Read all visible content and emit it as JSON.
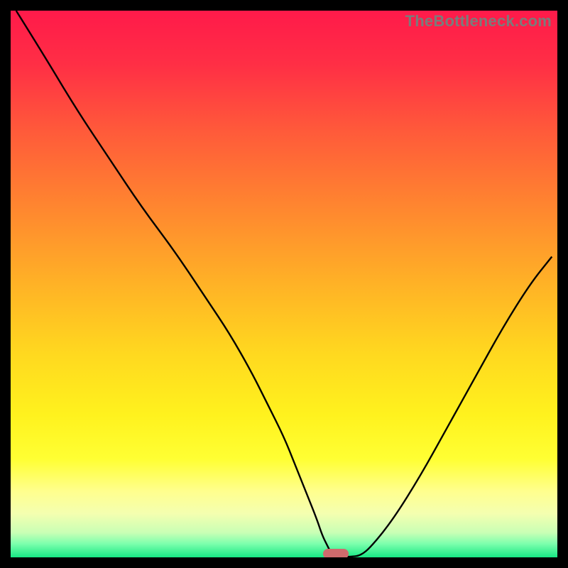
{
  "watermark": "TheBottleneck.com",
  "colors": {
    "frame": "#000000",
    "watermark": "#7b7b7b",
    "curve": "#000000",
    "sweet_spot": "#cf6b6d",
    "gradient_stops": [
      {
        "offset": 0.0,
        "color": "#ff1a4a"
      },
      {
        "offset": 0.1,
        "color": "#ff2f45"
      },
      {
        "offset": 0.22,
        "color": "#ff5a3a"
      },
      {
        "offset": 0.35,
        "color": "#ff8330"
      },
      {
        "offset": 0.5,
        "color": "#ffb226"
      },
      {
        "offset": 0.63,
        "color": "#ffd91f"
      },
      {
        "offset": 0.74,
        "color": "#fff21e"
      },
      {
        "offset": 0.82,
        "color": "#ffff33"
      },
      {
        "offset": 0.88,
        "color": "#ffff8f"
      },
      {
        "offset": 0.92,
        "color": "#f4ffb0"
      },
      {
        "offset": 0.955,
        "color": "#c9ffb5"
      },
      {
        "offset": 0.975,
        "color": "#7dffad"
      },
      {
        "offset": 1.0,
        "color": "#17e884"
      }
    ]
  },
  "chart_data": {
    "type": "line",
    "title": "",
    "xlabel": "",
    "ylabel": "",
    "xlim": [
      0,
      100
    ],
    "ylim": [
      0,
      100
    ],
    "grid": false,
    "legend": false,
    "x": [
      1,
      6,
      12,
      18,
      24,
      30,
      36,
      40,
      44,
      47,
      50,
      52,
      54,
      56,
      57,
      58,
      58.5,
      59,
      59.5,
      60,
      62,
      64,
      66,
      70,
      75,
      80,
      85,
      90,
      95,
      99
    ],
    "values": [
      100,
      92,
      82,
      73,
      64,
      56,
      47,
      41,
      34,
      28,
      22,
      17,
      12,
      7,
      4,
      2,
      1,
      0.4,
      0.2,
      0.1,
      0.1,
      0.3,
      2,
      7,
      15,
      24,
      33,
      42,
      50,
      55
    ],
    "sweet_spot_x": 59.5,
    "annotations": [
      {
        "text": "TheBottleneck.com",
        "position": "top-right"
      }
    ]
  }
}
